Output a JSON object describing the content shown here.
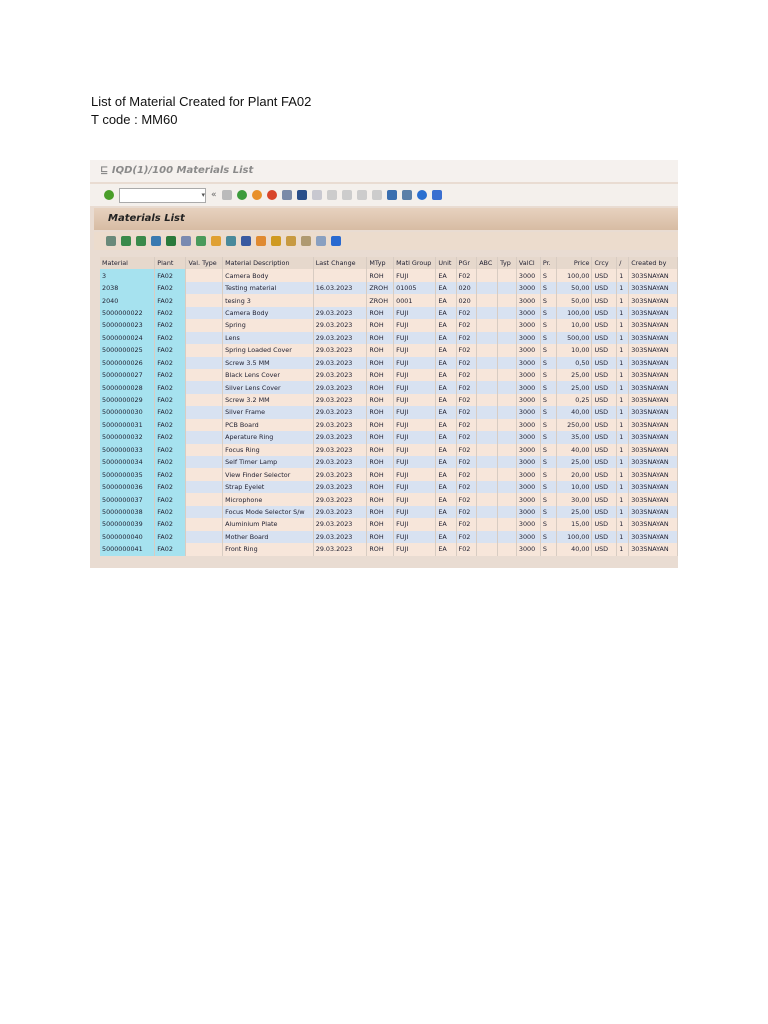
{
  "doc": {
    "line1": "List of Material Created for Plant FA02",
    "line2": "T code : MM60"
  },
  "window": {
    "title": "IQD(1)/100 Materials List",
    "command_field": "▾",
    "back": "«",
    "list_title": "Materials List"
  },
  "columns": [
    "Material",
    "Plant",
    "Val. Type",
    "Material Description",
    "Last Change",
    "MTyp",
    "Matl Group",
    "Unit",
    "PGr",
    "ABC",
    "Typ",
    "ValCl",
    "Pr.",
    "Price",
    "Crcy",
    "/",
    "Created by"
  ],
  "rows": [
    [
      "3",
      "FA02",
      "",
      "Camera Body",
      "",
      "ROH",
      "FUJI",
      "EA",
      "F02",
      "",
      "",
      "3000",
      "S",
      "100,00",
      "USD",
      "1",
      "303SNAYAN"
    ],
    [
      "2038",
      "FA02",
      "",
      "Testing material",
      "16.03.2023",
      "ZROH",
      "01005",
      "EA",
      "020",
      "",
      "",
      "3000",
      "S",
      "50,00",
      "USD",
      "1",
      "303SNAYAN"
    ],
    [
      "2040",
      "FA02",
      "",
      "tesing 3",
      "",
      "ZROH",
      "0001",
      "EA",
      "020",
      "",
      "",
      "3000",
      "S",
      "50,00",
      "USD",
      "1",
      "303SNAYAN"
    ],
    [
      "5000000022",
      "FA02",
      "",
      "Camera Body",
      "29.03.2023",
      "ROH",
      "FUJI",
      "EA",
      "F02",
      "",
      "",
      "3000",
      "S",
      "100,00",
      "USD",
      "1",
      "303SNAYAN"
    ],
    [
      "5000000023",
      "FA02",
      "",
      "Spring",
      "29.03.2023",
      "ROH",
      "FUJI",
      "EA",
      "F02",
      "",
      "",
      "3000",
      "S",
      "10,00",
      "USD",
      "1",
      "303SNAYAN"
    ],
    [
      "5000000024",
      "FA02",
      "",
      "Lens",
      "29.03.2023",
      "ROH",
      "FUJI",
      "EA",
      "F02",
      "",
      "",
      "3000",
      "S",
      "500,00",
      "USD",
      "1",
      "303SNAYAN"
    ],
    [
      "5000000025",
      "FA02",
      "",
      "Spring Loaded Cover",
      "29.03.2023",
      "ROH",
      "FUJI",
      "EA",
      "F02",
      "",
      "",
      "3000",
      "S",
      "10,00",
      "USD",
      "1",
      "303SNAYAN"
    ],
    [
      "5000000026",
      "FA02",
      "",
      "Screw 3.5 MM",
      "29.03.2023",
      "ROH",
      "FUJI",
      "EA",
      "F02",
      "",
      "",
      "3000",
      "S",
      "0,50",
      "USD",
      "1",
      "303SNAYAN"
    ],
    [
      "5000000027",
      "FA02",
      "",
      "Black Lens Cover",
      "29.03.2023",
      "ROH",
      "FUJI",
      "EA",
      "F02",
      "",
      "",
      "3000",
      "S",
      "25,00",
      "USD",
      "1",
      "303SNAYAN"
    ],
    [
      "5000000028",
      "FA02",
      "",
      "Silver Lens Cover",
      "29.03.2023",
      "ROH",
      "FUJI",
      "EA",
      "F02",
      "",
      "",
      "3000",
      "S",
      "25,00",
      "USD",
      "1",
      "303SNAYAN"
    ],
    [
      "5000000029",
      "FA02",
      "",
      "Screw 3.2 MM",
      "29.03.2023",
      "ROH",
      "FUJI",
      "EA",
      "F02",
      "",
      "",
      "3000",
      "S",
      "0,25",
      "USD",
      "1",
      "303SNAYAN"
    ],
    [
      "5000000030",
      "FA02",
      "",
      "Silver Frame",
      "29.03.2023",
      "ROH",
      "FUJI",
      "EA",
      "F02",
      "",
      "",
      "3000",
      "S",
      "40,00",
      "USD",
      "1",
      "303SNAYAN"
    ],
    [
      "5000000031",
      "FA02",
      "",
      "PCB Board",
      "29.03.2023",
      "ROH",
      "FUJI",
      "EA",
      "F02",
      "",
      "",
      "3000",
      "S",
      "250,00",
      "USD",
      "1",
      "303SNAYAN"
    ],
    [
      "5000000032",
      "FA02",
      "",
      "Aperature Ring",
      "29.03.2023",
      "ROH",
      "FUJI",
      "EA",
      "F02",
      "",
      "",
      "3000",
      "S",
      "35,00",
      "USD",
      "1",
      "303SNAYAN"
    ],
    [
      "5000000033",
      "FA02",
      "",
      "Focus Ring",
      "29.03.2023",
      "ROH",
      "FUJI",
      "EA",
      "F02",
      "",
      "",
      "3000",
      "S",
      "40,00",
      "USD",
      "1",
      "303SNAYAN"
    ],
    [
      "5000000034",
      "FA02",
      "",
      "Self Timer Lamp",
      "29.03.2023",
      "ROH",
      "FUJI",
      "EA",
      "F02",
      "",
      "",
      "3000",
      "S",
      "25,00",
      "USD",
      "1",
      "303SNAYAN"
    ],
    [
      "5000000035",
      "FA02",
      "",
      "View Finder Selector",
      "29.03.2023",
      "ROH",
      "FUJI",
      "EA",
      "F02",
      "",
      "",
      "3000",
      "S",
      "20,00",
      "USD",
      "1",
      "303SNAYAN"
    ],
    [
      "5000000036",
      "FA02",
      "",
      "Strap Eyelet",
      "29.03.2023",
      "ROH",
      "FUJI",
      "EA",
      "F02",
      "",
      "",
      "3000",
      "S",
      "10,00",
      "USD",
      "1",
      "303SNAYAN"
    ],
    [
      "5000000037",
      "FA02",
      "",
      "Microphone",
      "29.03.2023",
      "ROH",
      "FUJI",
      "EA",
      "F02",
      "",
      "",
      "3000",
      "S",
      "30,00",
      "USD",
      "1",
      "303SNAYAN"
    ],
    [
      "5000000038",
      "FA02",
      "",
      "Focus Mode Selector S/w",
      "29.03.2023",
      "ROH",
      "FUJI",
      "EA",
      "F02",
      "",
      "",
      "3000",
      "S",
      "25,00",
      "USD",
      "1",
      "303SNAYAN"
    ],
    [
      "5000000039",
      "FA02",
      "",
      "Aluminium Plate",
      "29.03.2023",
      "ROH",
      "FUJI",
      "EA",
      "F02",
      "",
      "",
      "3000",
      "S",
      "15,00",
      "USD",
      "1",
      "303SNAYAN"
    ],
    [
      "5000000040",
      "FA02",
      "",
      "Mother Board",
      "29.03.2023",
      "ROH",
      "FUJI",
      "EA",
      "F02",
      "",
      "",
      "3000",
      "S",
      "100,00",
      "USD",
      "1",
      "303SNAYAN"
    ],
    [
      "5000000041",
      "FA02",
      "",
      "Front Ring",
      "29.03.2023",
      "ROH",
      "FUJI",
      "EA",
      "F02",
      "",
      "",
      "3000",
      "S",
      "40,00",
      "USD",
      "1",
      "303SNAYAN"
    ]
  ]
}
